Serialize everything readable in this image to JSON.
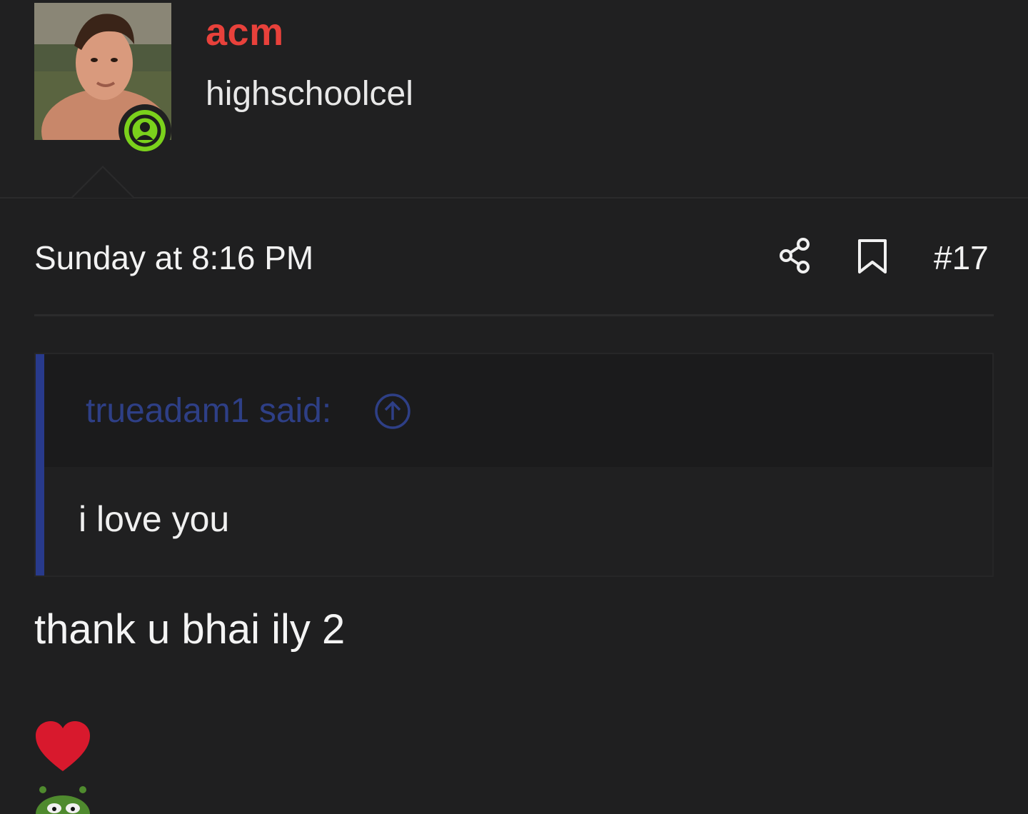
{
  "user": {
    "username": "acm",
    "title": "highschoolcel",
    "username_color": "#e8413b",
    "status_color": "#7bd11c",
    "avatar_icon": "user-avatar-photo",
    "status_icon": "online-user-icon"
  },
  "post": {
    "date": "Sunday at 8:16 PM",
    "number": "#17",
    "share_icon": "share-icon",
    "bookmark_icon": "bookmark-icon"
  },
  "quote": {
    "author": "trueadam1 said:",
    "text": "i love you",
    "accent_color": "#283a8c",
    "jump_icon": "arrow-up-circle-icon"
  },
  "message": {
    "text": "thank u bhai ily 2",
    "emojis": [
      "heart-emoji",
      "pepe-emoji"
    ]
  }
}
